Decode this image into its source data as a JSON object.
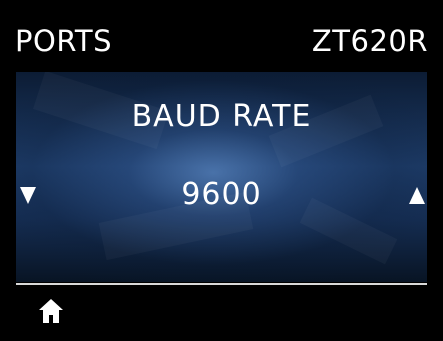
{
  "header": {
    "menu": "PORTS",
    "model": "ZT620R"
  },
  "setting": {
    "title": "BAUD RATE",
    "value": "9600"
  },
  "navigation": {
    "left_icon": "down-triangle-icon",
    "right_icon": "up-triangle-icon",
    "home_icon": "home-icon"
  },
  "colors": {
    "background": "#000000",
    "panel_center": "#3a6bb0",
    "panel_dark": "#081424",
    "text": "#ffffff"
  }
}
